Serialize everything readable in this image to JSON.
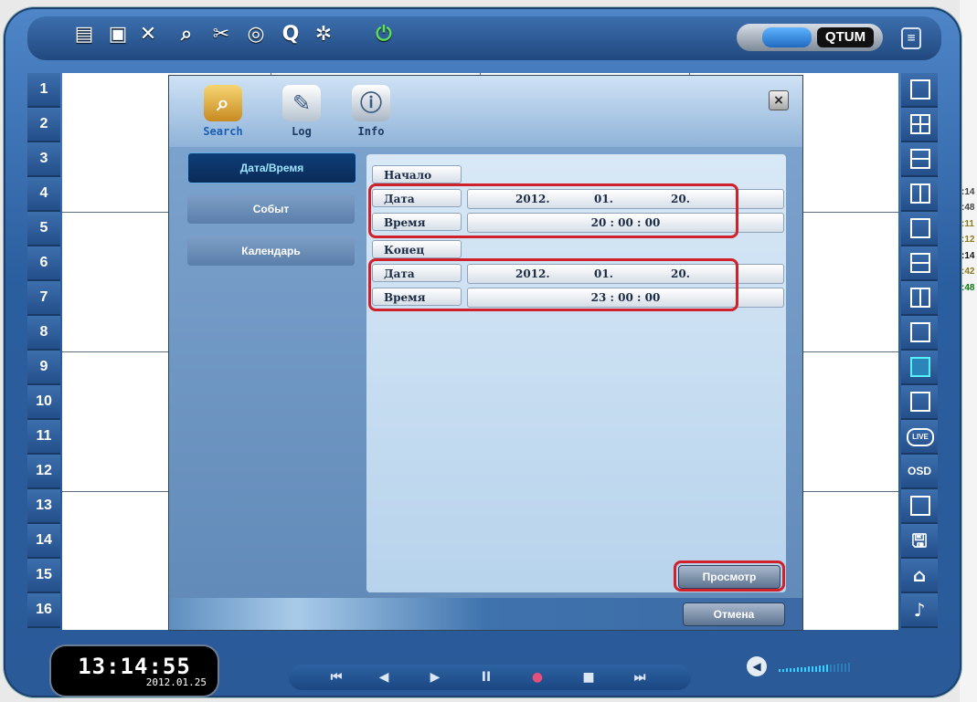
{
  "desktop_right_values": [
    ":14",
    ":48",
    ":11",
    ":12",
    ":14",
    ":42",
    ":48"
  ],
  "brand": {
    "name": "QTUM"
  },
  "toolbar_icons": [
    "export-icon",
    "backup-icon",
    "tools-icon",
    "search-icon",
    "settings-icon",
    "ptz-icon",
    "zoom-icon",
    "config-icon",
    "power-icon"
  ],
  "channels": [
    "1",
    "2",
    "3",
    "4",
    "5",
    "6",
    "7",
    "8",
    "9",
    "10",
    "11",
    "12",
    "13",
    "14",
    "15",
    "16"
  ],
  "layout_buttons": {
    "live": "LIVE",
    "osd": "OSD"
  },
  "dialog": {
    "tabs": [
      {
        "label": "Search"
      },
      {
        "label": "Log"
      },
      {
        "label": "Info"
      }
    ],
    "close": "×",
    "sidebar": [
      {
        "label": "Дата/Время"
      },
      {
        "label": "Событ"
      },
      {
        "label": "Календарь"
      }
    ],
    "start": {
      "header": "Начало",
      "date_label": "Дата",
      "date_year": "2012.",
      "date_month": "01.",
      "date_day": "20.",
      "time_label": "Время",
      "time_value": "20 : 00 : 00"
    },
    "end": {
      "header": "Конец",
      "date_label": "Дата",
      "date_year": "2012.",
      "date_month": "01.",
      "date_day": "20.",
      "time_label": "Время",
      "time_value": "23 : 00 : 00"
    },
    "view_button": "Просмотр",
    "cancel_button": "Отмена"
  },
  "clock": {
    "time": "13:14:55",
    "date": "2012.01.25"
  },
  "playback": {
    "buttons": [
      "⏮",
      "◀",
      "▶",
      "II",
      "●",
      "■",
      "⏭"
    ]
  },
  "volume": {
    "level": 0.7
  },
  "colors": {
    "frame": "#2b5e9f",
    "highlight": "#d0202a",
    "active_layout": "#59f1ff"
  }
}
